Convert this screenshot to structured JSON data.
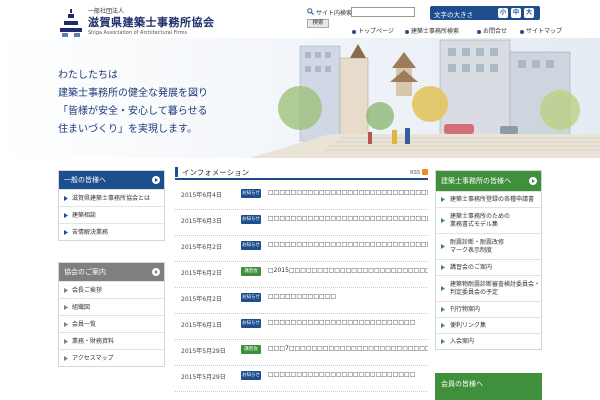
{
  "header": {
    "logo_sub": "一般社団法人",
    "logo_title": "滋賀県建築士事務所協会",
    "logo_en": "Shiga Association of Architectural Firms",
    "search_label": "サイト内検索",
    "search_placeholder": "",
    "search_button": "検索",
    "fontsize_label": "文字の大きさ",
    "fontsize_small": "小",
    "fontsize_medium": "中",
    "fontsize_large": "大"
  },
  "gnav": {
    "items": [
      "トップページ",
      "建築士事務所検索",
      "お問合せ",
      "サイトマップ"
    ]
  },
  "hero": {
    "lines": [
      "わたしたちは",
      "建築士事務所の健全な発展を図り",
      "「皆様が安全・安心して暮らせる",
      "住まいづくり」を実現します。"
    ]
  },
  "left_sidebar": {
    "public": {
      "title": "一般の皆様へ",
      "items": [
        "滋賀県建築士事務所協会とは",
        "建築相談",
        "苦情解決業務"
      ]
    },
    "association": {
      "title": "協会のご案内",
      "items": [
        "会長ご挨拶",
        "組織図",
        "会員一覧",
        "業務・財務資料",
        "アクセスマップ"
      ]
    }
  },
  "info": {
    "title": "インフォメーション",
    "rss": "RSS",
    "news": [
      {
        "date": "2015年6月4日",
        "badge": "お知らせ",
        "badge_type": "notice",
        "title": "□□□□□□□□□□□□□□□□□□□□□□□□□□□□□□□□□"
      },
      {
        "date": "2015年6月3日",
        "badge": "お知らせ",
        "badge_type": "notice",
        "title": "□□□□□□□□□□□□□□□□□□□□□□□□□□□□□□□□□□□□□□□□□□□□□□□□□□□"
      },
      {
        "date": "2015年6月2日",
        "badge": "お知らせ",
        "badge_type": "notice",
        "title": "□□□□□□□□□□□□□□□□□□□□□□□□□□□□□□□□□"
      },
      {
        "date": "2015年6月2日",
        "badge": "講習会",
        "badge_type": "lecture",
        "title": "□2015□□□□□□□□□□□□□□□□□□□□□□□□□□□□□□□□□□□□□□□□□□"
      },
      {
        "date": "2015年6月2日",
        "badge": "お知らせ",
        "badge_type": "notice",
        "title": "□□□□□□□□□□□□"
      },
      {
        "date": "2015年6月1日",
        "badge": "お知らせ",
        "badge_type": "notice",
        "title": "□□□□□□□□□□□□□□□□□□□□□□□□□□"
      },
      {
        "date": "2015年5月29日",
        "badge": "講習会",
        "badge_type": "lecture",
        "title": "□□□7□□□□□□□□□□□□□□□□□□□□□□□□□□□□□□□□□□□□□□□□□□□"
      },
      {
        "date": "2015年5月29日",
        "badge": "お知らせ",
        "badge_type": "notice",
        "title": "□□□□□□□□□□□□□□□□□□□□□□□□□□"
      }
    ]
  },
  "right_sidebar": {
    "title": "建築士事務所の皆様へ",
    "items": [
      "建築士事務所登録の各種申請書",
      "建築士事務所のための\n業務書式モデル集",
      "耐震診断・耐震改修\nマーク表示制度",
      "講習会のご案内",
      "建築物耐震診断審査検討委員会・\n判定委員会の予定",
      "刊行物案内",
      "便利リンク集",
      "入会案内"
    ],
    "members_title": "会員の皆様へ"
  },
  "colors": {
    "brand_blue": "#1d4f8f",
    "brand_green": "#3f8f3c",
    "badge_notice": "#1d4f8f",
    "badge_lecture": "#3f8f3c",
    "rss_orange": "#f08c1f"
  }
}
